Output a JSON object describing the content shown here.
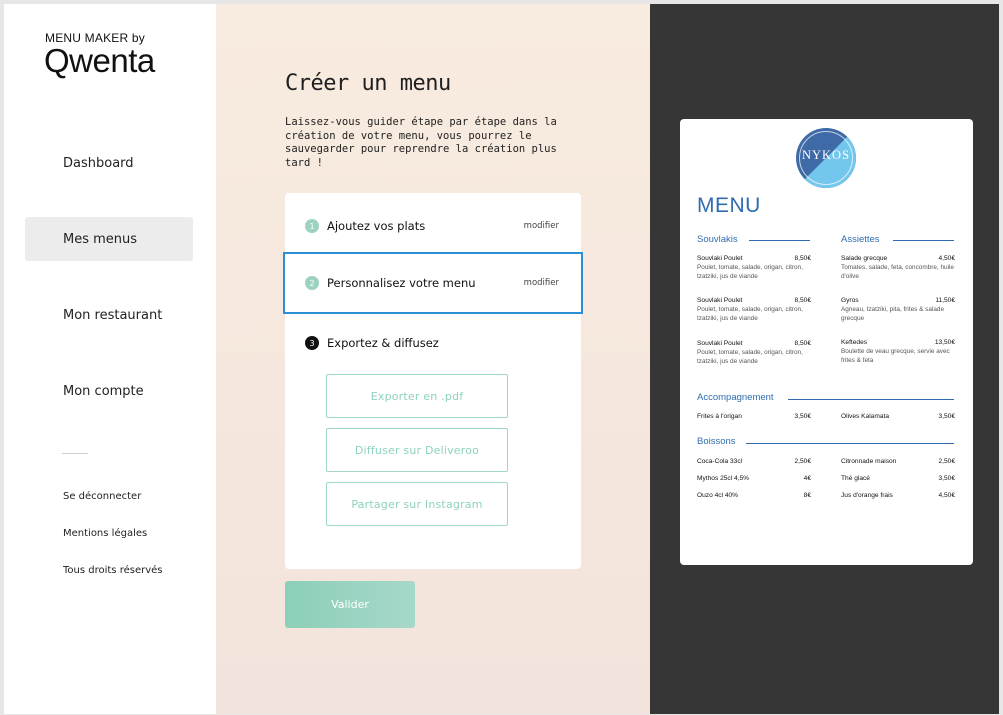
{
  "brand": {
    "top": "MENU MAKER by",
    "logo": "Qwenta"
  },
  "nav": {
    "dashboard": "Dashboard",
    "mes_menus": "Mes menus",
    "mon_restaurant": "Mon restaurant",
    "mon_compte": "Mon compte"
  },
  "footer": {
    "logout": "Se déconnecter",
    "legal": "Mentions légales",
    "rights": "Tous droits réservés"
  },
  "page": {
    "title": "Créer un menu",
    "description": "Laissez-vous guider étape par étape dans la création de votre menu, vous pourrez le sauvegarder pour reprendre la création plus tard !"
  },
  "steps": [
    {
      "num": "1",
      "label": "Ajoutez vos plats",
      "action": "modifier"
    },
    {
      "num": "2",
      "label": "Personnalisez votre menu",
      "action": "modifier"
    },
    {
      "num": "3",
      "label": "Exportez & diffusez"
    }
  ],
  "actions": {
    "pdf": "Exporter en .pdf",
    "deliveroo": "Diffuser sur Deliveroo",
    "instagram": "Partager sur Instagram"
  },
  "submit": "Valider",
  "preview": {
    "logo_text": "NYKOS",
    "title": "MENU",
    "sections": {
      "souvlakis": "Souvlakis",
      "assiettes": "Assiettes",
      "accompagnement": "Accompagnement",
      "boissons": "Boissons"
    },
    "souvlakis": [
      {
        "name": "Souvlaki Poulet",
        "price": "8,50€",
        "desc": "Poulet, tomate, salade, origan, citron, tzatziki, jus de viande"
      },
      {
        "name": "Souvlaki Poulet",
        "price": "8,50€",
        "desc": "Poulet, tomate, salade, origan, citron, tzatziki, jus de viande"
      },
      {
        "name": "Souvlaki Poulet",
        "price": "8,50€",
        "desc": "Poulet, tomate, salade, origan, citron, tzatziki, jus de viande"
      }
    ],
    "assiettes": [
      {
        "name": "Salade grecque",
        "price": "4,50€",
        "desc": "Tomates, salade, feta, concombre, huile d'olive"
      },
      {
        "name": "Gyros",
        "price": "11,50€",
        "desc": "Agneau, tzatziki, pita, frites & salade grecque"
      },
      {
        "name": "Keftedes",
        "price": "13,50€",
        "desc": "Boulette de veau grecque, servie avec frites & feta"
      }
    ],
    "accompagnement": [
      {
        "name": "Frites à l'origan",
        "price": "3,50€"
      },
      {
        "name": "Olives Kalamata",
        "price": "3,50€"
      }
    ],
    "boissons_left": [
      {
        "name": "Coca-Cola 33cl",
        "price": "2,50€"
      },
      {
        "name": "Mythos 25cl 4,5%",
        "price": "4€"
      },
      {
        "name": "Ouzo 4cl 40%",
        "price": "8€"
      }
    ],
    "boissons_right": [
      {
        "name": "Citronnade maison",
        "price": "2,50€"
      },
      {
        "name": "Thé glacé",
        "price": "3,50€"
      },
      {
        "name": "Jus d'orange frais",
        "price": "4,50€"
      }
    ]
  }
}
